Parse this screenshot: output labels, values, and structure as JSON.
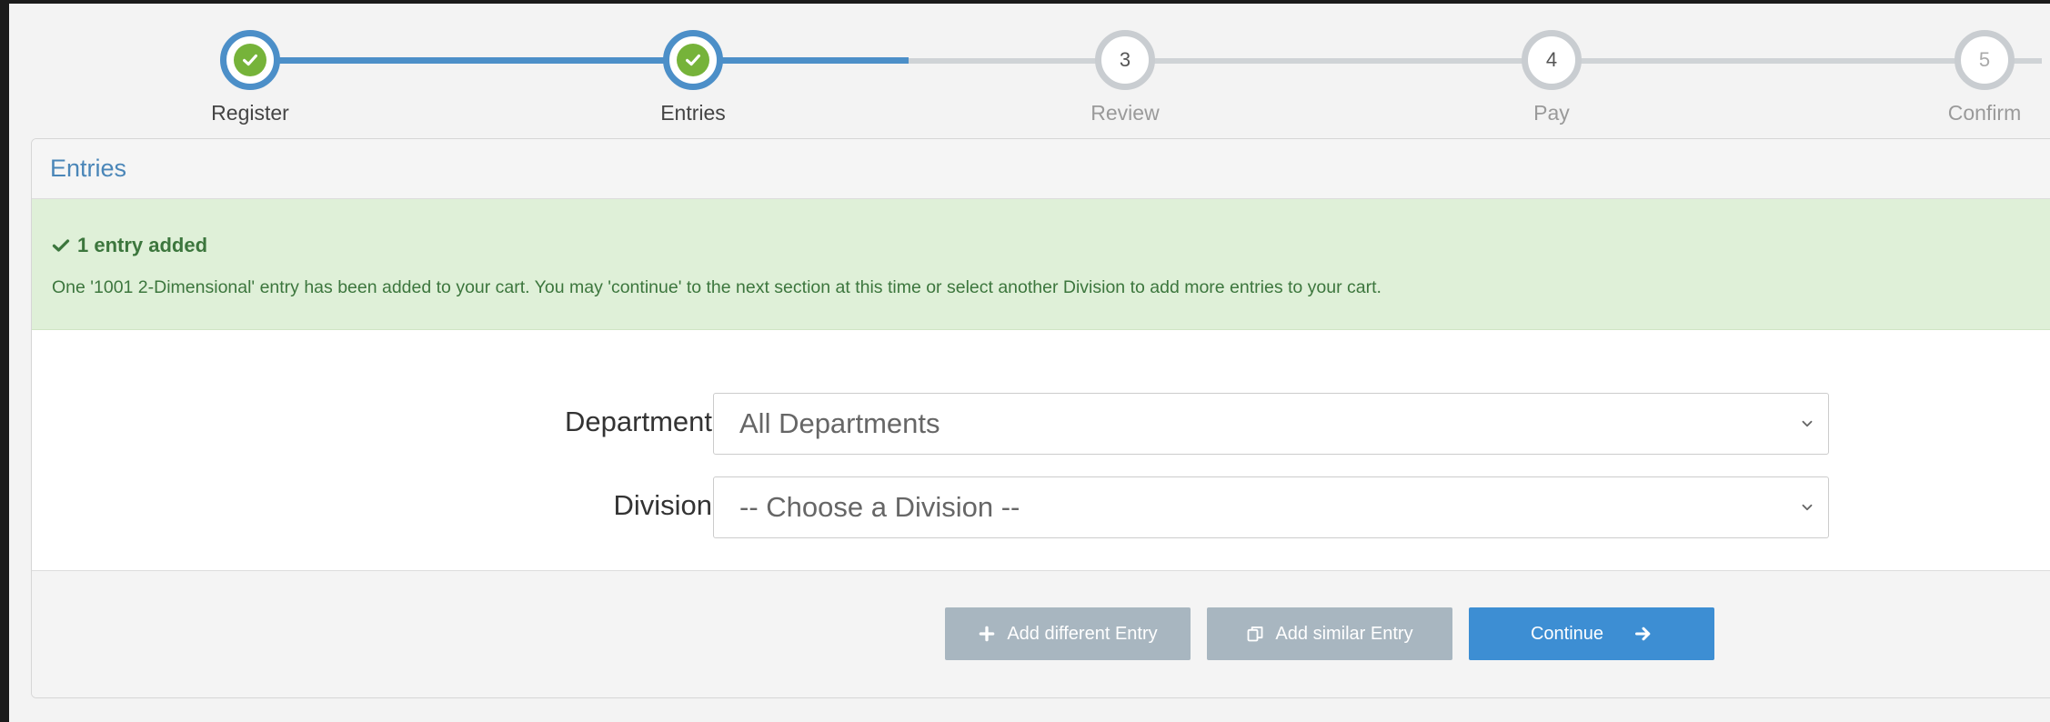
{
  "steps": [
    {
      "label": "Register",
      "status": "done"
    },
    {
      "label": "Entries",
      "status": "done"
    },
    {
      "label": "Review",
      "number": "3",
      "status": "pending"
    },
    {
      "label": "Pay",
      "number": "4",
      "status": "pending"
    },
    {
      "label": "Confirm",
      "number": "5",
      "status": "pending"
    }
  ],
  "panel": {
    "title": "Entries"
  },
  "alert": {
    "title": "1 entry added",
    "message": "One '1001 2-Dimensional' entry has been added to your cart. You may 'continue' to the next section at this time or select another Division to add more entries to your cart."
  },
  "form": {
    "department_label": "Department",
    "department_value": "All Departments",
    "division_label": "Division",
    "division_value": "-- Choose a Division --"
  },
  "buttons": {
    "add_different": "Add different Entry",
    "add_similar": "Add similar Entry",
    "continue": "Continue"
  },
  "colors": {
    "accent": "#4c8fc8",
    "success": "#76b33a",
    "alert_bg": "#dff0d8",
    "primary_button": "#3d8ed3",
    "secondary_button": "#a8b6c0"
  }
}
